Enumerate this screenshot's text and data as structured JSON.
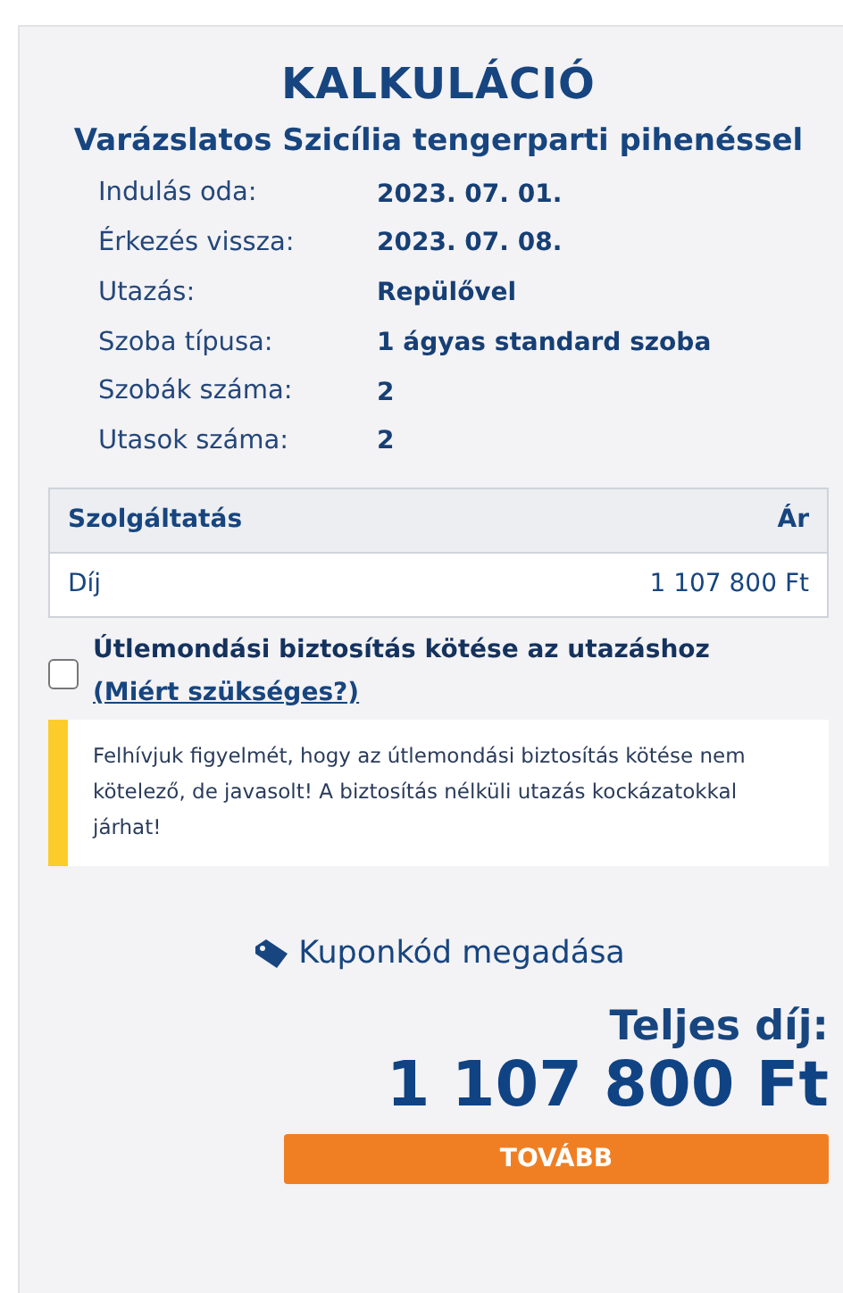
{
  "title": "KALKULÁCIÓ",
  "subtitle": "Varázslatos Szicília tengerparti pihenéssel",
  "details": [
    {
      "label": "Indulás oda:",
      "value": "2023. 07. 01."
    },
    {
      "label": "Érkezés vissza:",
      "value": "2023. 07. 08."
    },
    {
      "label": "Utazás:",
      "value": "Repülővel"
    },
    {
      "label": "Szoba típusa:",
      "value": "1 ágyas standard szoba"
    },
    {
      "label": "Szobák száma:",
      "value": "2"
    },
    {
      "label": "Utasok száma:",
      "value": "2"
    }
  ],
  "table": {
    "columns": [
      "Szolgáltatás",
      "Ár"
    ],
    "rows": [
      [
        "Díj",
        "1 107 800 Ft"
      ]
    ]
  },
  "insurance": {
    "label": "Útlemondási biztosítás kötése az utazáshoz",
    "link": "(Miért szükséges?)",
    "checked": false
  },
  "warning": "Felhívjuk figyelmét, hogy az útlemondási biztosítás kötése nem kötelező, de javasolt! A biztosítás nélküli utazás kockázatokkal járhat!",
  "coupon": "Kuponkód megadása",
  "total": {
    "label": "Teljes díj:",
    "value": "1 107 800 Ft"
  },
  "button": "TOVÁBB"
}
